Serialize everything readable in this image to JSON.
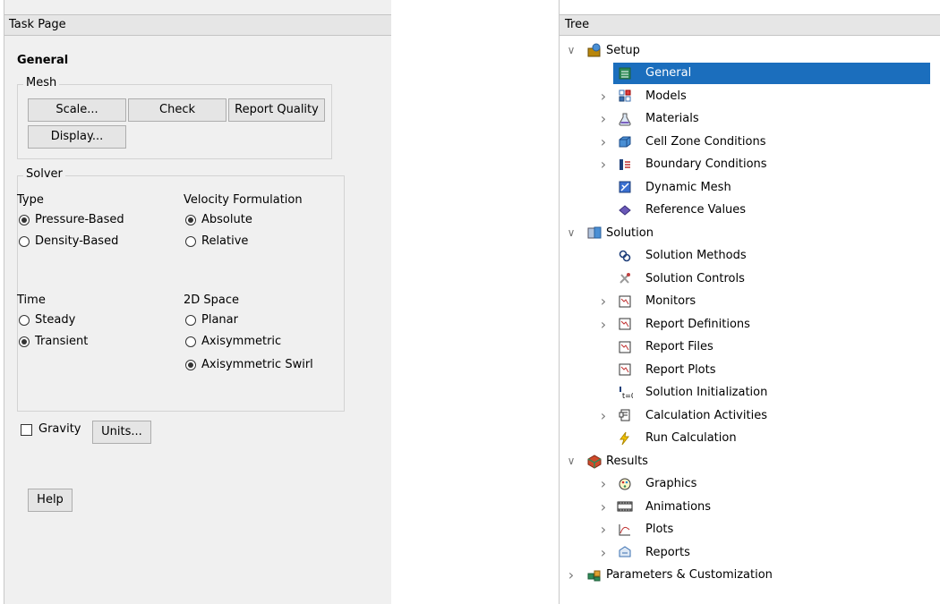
{
  "task_page": {
    "header": "Task Page",
    "title": "General",
    "mesh": {
      "legend": "Mesh",
      "scale_label": "Scale...",
      "check_label": "Check",
      "report_quality_label": "Report Quality",
      "display_label": "Display..."
    },
    "solver": {
      "legend": "Solver",
      "type_label": "Type",
      "type_options": [
        "Pressure-Based",
        "Density-Based"
      ],
      "type_selected": "Pressure-Based",
      "velocity_label": "Velocity Formulation",
      "velocity_options": [
        "Absolute",
        "Relative"
      ],
      "velocity_selected": "Absolute",
      "time_label": "Time",
      "time_options": [
        "Steady",
        "Transient"
      ],
      "time_selected": "Transient",
      "space_label": "2D Space",
      "space_options": [
        "Planar",
        "Axisymmetric",
        "Axisymmetric Swirl"
      ],
      "space_selected": "Axisymmetric Swirl"
    },
    "gravity_label": "Gravity",
    "gravity_checked": false,
    "units_label": "Units...",
    "help_label": "Help"
  },
  "tree": {
    "header": "Tree",
    "items": [
      {
        "label": "Setup",
        "level": 0,
        "expander": "expanded",
        "icon": "setup-icon"
      },
      {
        "label": "General",
        "level": 1,
        "expander": "none",
        "icon": "general-icon",
        "selected": true
      },
      {
        "label": "Models",
        "level": 1,
        "expander": "collapsed",
        "icon": "models-icon"
      },
      {
        "label": "Materials",
        "level": 1,
        "expander": "collapsed",
        "icon": "materials-icon"
      },
      {
        "label": "Cell Zone Conditions",
        "level": 1,
        "expander": "collapsed",
        "icon": "cell-zone-icon"
      },
      {
        "label": "Boundary Conditions",
        "level": 1,
        "expander": "collapsed",
        "icon": "boundary-icon"
      },
      {
        "label": "Dynamic Mesh",
        "level": 1,
        "expander": "none",
        "icon": "dynamic-mesh-icon"
      },
      {
        "label": "Reference Values",
        "level": 1,
        "expander": "none",
        "icon": "reference-values-icon"
      },
      {
        "label": "Solution",
        "level": 0,
        "expander": "expanded",
        "icon": "solution-icon"
      },
      {
        "label": "Solution Methods",
        "level": 1,
        "expander": "none",
        "icon": "solution-methods-icon"
      },
      {
        "label": "Solution Controls",
        "level": 1,
        "expander": "none",
        "icon": "solution-controls-icon"
      },
      {
        "label": "Monitors",
        "level": 1,
        "expander": "collapsed",
        "icon": "monitors-icon"
      },
      {
        "label": "Report Definitions",
        "level": 1,
        "expander": "collapsed",
        "icon": "report-definitions-icon"
      },
      {
        "label": "Report Files",
        "level": 1,
        "expander": "none",
        "icon": "report-files-icon"
      },
      {
        "label": "Report Plots",
        "level": 1,
        "expander": "none",
        "icon": "report-plots-icon"
      },
      {
        "label": "Solution Initialization",
        "level": 1,
        "expander": "none",
        "icon": "solution-initialization-icon"
      },
      {
        "label": "Calculation Activities",
        "level": 1,
        "expander": "collapsed",
        "icon": "calculation-activities-icon"
      },
      {
        "label": "Run Calculation",
        "level": 1,
        "expander": "none",
        "icon": "run-calculation-icon"
      },
      {
        "label": "Results",
        "level": 0,
        "expander": "expanded",
        "icon": "results-icon"
      },
      {
        "label": "Graphics",
        "level": 1,
        "expander": "collapsed",
        "icon": "graphics-icon"
      },
      {
        "label": "Animations",
        "level": 1,
        "expander": "collapsed",
        "icon": "animations-icon"
      },
      {
        "label": "Plots",
        "level": 1,
        "expander": "collapsed",
        "icon": "plots-icon"
      },
      {
        "label": "Reports",
        "level": 1,
        "expander": "collapsed",
        "icon": "reports-icon"
      },
      {
        "label": "Parameters & Customization",
        "level": 0,
        "expander": "collapsed",
        "icon": "parameters-icon"
      }
    ]
  },
  "colors": {
    "selection": "#1b6ebd",
    "panel_bg": "#f0f0f0",
    "header_bg": "#e6e6e6"
  }
}
